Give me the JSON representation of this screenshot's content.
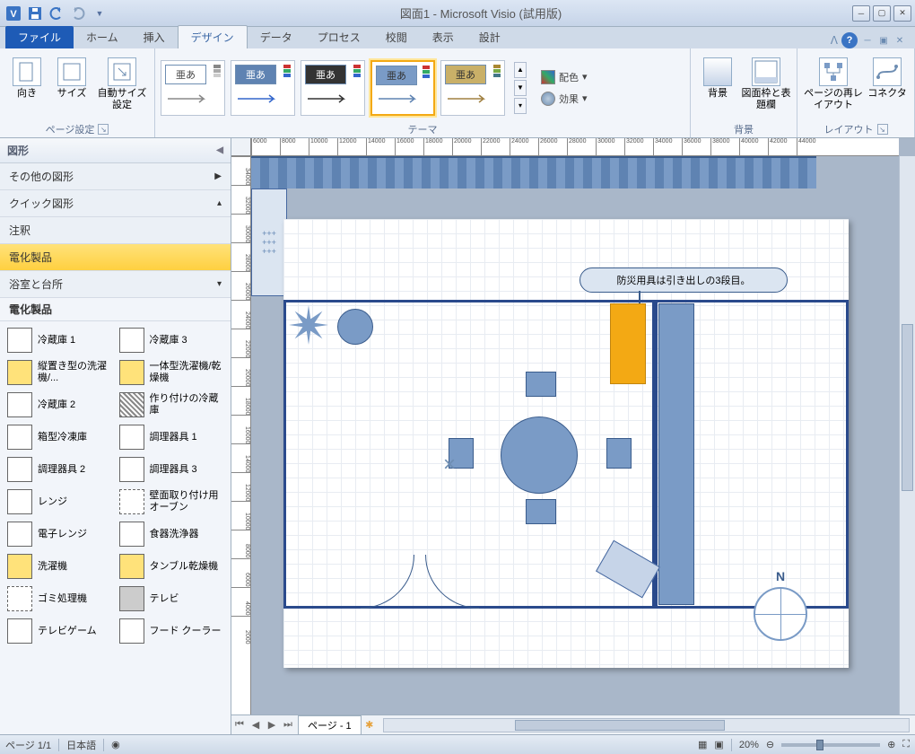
{
  "title": "図面1 - Microsoft Visio (試用版)",
  "tabs": {
    "file": "ファイル",
    "home": "ホーム",
    "insert": "挿入",
    "design": "デザイン",
    "data": "データ",
    "process": "プロセス",
    "review": "校閲",
    "view": "表示",
    "design2": "設計"
  },
  "ribbon": {
    "page_setup": {
      "orientation": "向き",
      "size": "サイズ",
      "autosize": "自動サイズ設定",
      "group": "ページ設定"
    },
    "themes": {
      "group": "テーマ",
      "sample": "亜あ",
      "color_label": "配色",
      "effect_label": "効果"
    },
    "bg": {
      "background": "背景",
      "border": "図面枠と表題欄",
      "group": "背景"
    },
    "layout": {
      "relayout": "ページの再レイアウト",
      "connector": "コネクタ",
      "group": "レイアウト"
    }
  },
  "shapes": {
    "title": "図形",
    "stencils": {
      "more": "その他の図形",
      "quick": "クイック図形",
      "annotation": "注釈",
      "electrical": "電化製品",
      "bath": "浴室と台所"
    },
    "section": "電化製品",
    "items": [
      {
        "lbl": "冷蔵庫 1"
      },
      {
        "lbl": "冷蔵庫 3"
      },
      {
        "lbl": "縦置き型の洗濯機/..."
      },
      {
        "lbl": "一体型洗濯機/乾燥機"
      },
      {
        "lbl": "冷蔵庫 2"
      },
      {
        "lbl": "作り付けの冷蔵庫"
      },
      {
        "lbl": "箱型冷凍庫"
      },
      {
        "lbl": "調理器具 1"
      },
      {
        "lbl": "調理器具 2"
      },
      {
        "lbl": "調理器具 3"
      },
      {
        "lbl": "レンジ"
      },
      {
        "lbl": "壁面取り付け用オーブン"
      },
      {
        "lbl": "電子レンジ"
      },
      {
        "lbl": "食器洗浄器"
      },
      {
        "lbl": "洗濯機"
      },
      {
        "lbl": "タンブル乾燥機"
      },
      {
        "lbl": "ゴミ処理機"
      },
      {
        "lbl": "テレビ"
      },
      {
        "lbl": "テレビゲーム"
      },
      {
        "lbl": "フード クーラー"
      }
    ]
  },
  "ruler_h": [
    "6000",
    "8000",
    "10000",
    "12000",
    "14000",
    "16000",
    "18000",
    "20000",
    "22000",
    "24000",
    "26000",
    "28000",
    "30000",
    "32000",
    "34000",
    "36000",
    "38000",
    "40000",
    "42000",
    "44000"
  ],
  "ruler_v": [
    "34000",
    "32000",
    "30000",
    "28000",
    "26000",
    "24000",
    "22000",
    "20000",
    "18000",
    "16000",
    "14000",
    "12000",
    "10000",
    "8000",
    "6000",
    "4000",
    "2000"
  ],
  "callout_text": "防災用具は引き出しの3段目。",
  "compass_n": "N",
  "page_tab": "ページ - 1",
  "status": {
    "page": "ページ 1/1",
    "lang": "日本語",
    "zoom": "20%"
  }
}
